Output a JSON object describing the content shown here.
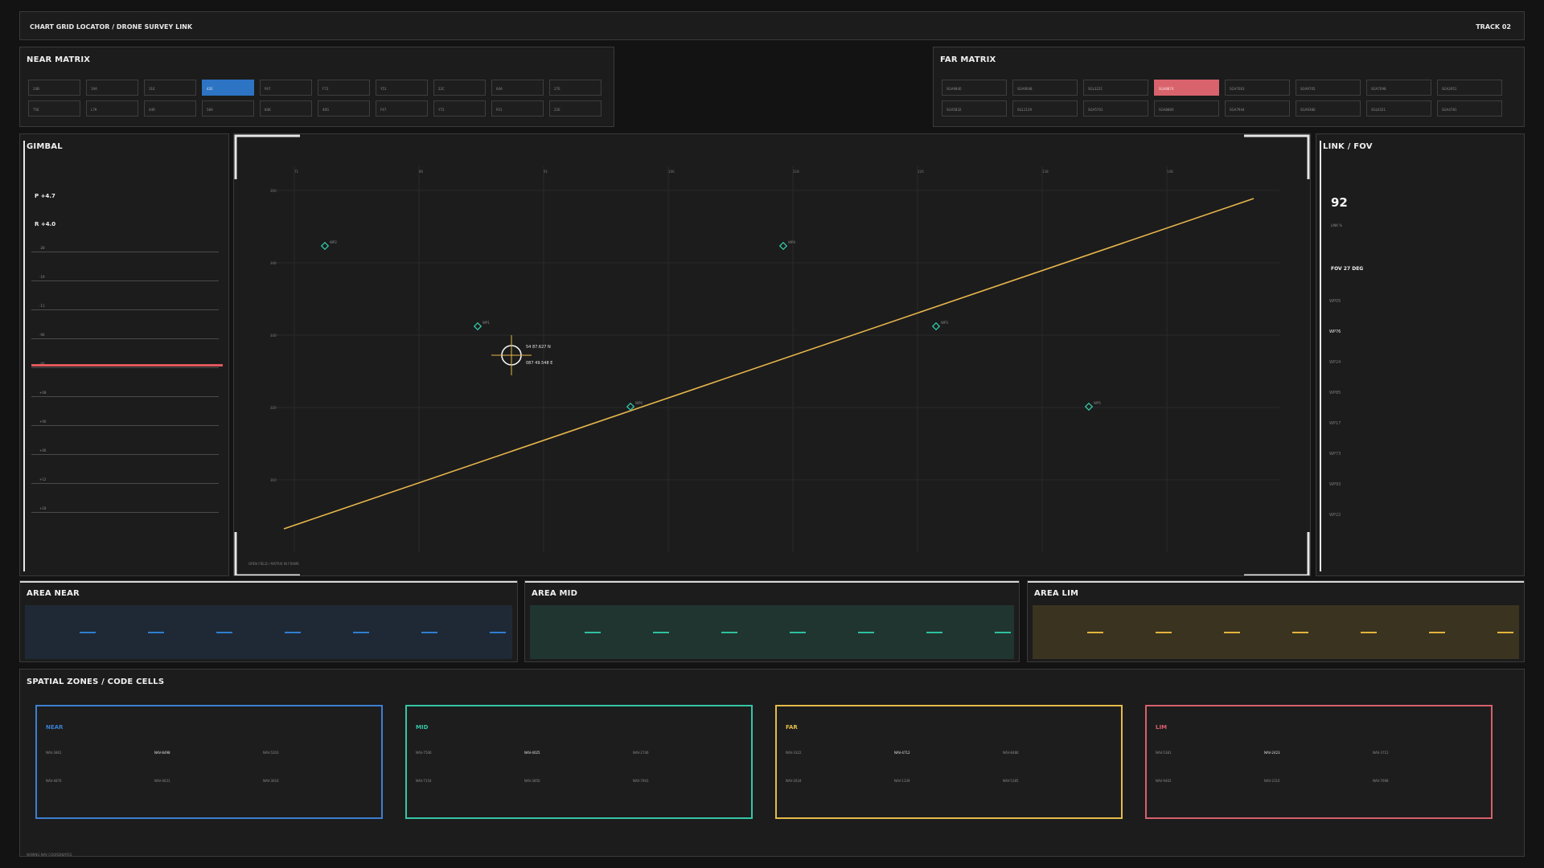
{
  "header": {
    "title": "CHART GRID LOCATOR  /  DRONE SURVEY LINK",
    "track": "TRACK 02"
  },
  "near_matrix": {
    "title": "NEAR MATRIX",
    "active_index": 3,
    "cells": [
      "24B",
      "19A",
      "31E",
      "42E",
      "P47",
      "F72",
      "Y51",
      "22C",
      "64A",
      "27E",
      "75E",
      "L79",
      "44R",
      "58A",
      "84K",
      "40G",
      "F47",
      "Y72",
      "P31",
      "22E"
    ]
  },
  "far_matrix": {
    "title": "FAR MATRIX",
    "active_index": 3,
    "cells": [
      "SGA9840",
      "SGA9048",
      "SGL3221",
      "SGA8874",
      "SGA7063",
      "SGA9705",
      "SGA7098",
      "SGA2951",
      "SGA5832",
      "SGL1129",
      "SGA5701",
      "SGA8860",
      "SGA7944",
      "SGA9380",
      "SGL0321",
      "SGA4781"
    ]
  },
  "gimbal": {
    "title": "GIMBAL",
    "pitch": "P +4.7",
    "roll": "R +4.0",
    "ticks": [
      "-28",
      "-19",
      "-11",
      "-06",
      "-04",
      "+08",
      "+06",
      "+06",
      "+12",
      "+18"
    ]
  },
  "plot": {
    "x_labels": [
      "71",
      "86",
      "91",
      "106",
      "118",
      "126",
      "138",
      "148"
    ],
    "y_labels": [
      "350",
      "340",
      "330",
      "320",
      "310"
    ],
    "waypoints": [
      "WP2",
      "WP4",
      "WP1",
      "WP3",
      "WP6",
      "WP5",
      "WP7"
    ],
    "coord_lat": "54 87.627 N",
    "coord_lon": "087 49.548 E",
    "footer": "OPEN FIELD  /  MATRIX IN FRAME",
    "trend_color": "#e8b64c",
    "waypoint_color": "#33c9a7"
  },
  "link_fov": {
    "title": "LINK / FOV",
    "link_value": "92",
    "link_label": "LINK %",
    "fov": "FOV 27 DEG",
    "waypoints": [
      "WP05",
      "WP76",
      "WP24",
      "WP85",
      "WP17",
      "WP73",
      "WP93",
      "WP22"
    ],
    "active_waypoint": 1
  },
  "areas": [
    {
      "title": "AREA NEAR",
      "color": "#2f7dd0",
      "bg": "#1f2935"
    },
    {
      "title": "AREA MID",
      "color": "#2fc1a0",
      "bg": "#213530"
    },
    {
      "title": "AREA LIM",
      "color": "#e3b43c",
      "bg": "#3a3320"
    }
  ],
  "zones": {
    "title": "SPATIAL ZONES  /  CODE CELLS",
    "footer": "NAMING NAV COORDINATES",
    "items": [
      {
        "name": "NEAR",
        "color": "#3c7fd1",
        "highlight": 1,
        "codes": [
          "NAV-3861",
          "NAV-8498",
          "NAV-5203",
          "NAV-4876",
          "NAV-4631",
          "NAV-3616"
        ]
      },
      {
        "name": "MID",
        "color": "#35c6a6",
        "highlight": 1,
        "codes": [
          "NAV-7506",
          "NAV-4025",
          "NAV-2746",
          "NAV-7154",
          "NAV-3850",
          "NAV-7941"
        ]
      },
      {
        "name": "FAR",
        "color": "#e5bc49",
        "highlight": 1,
        "codes": [
          "NAV-3322",
          "NAV-4712",
          "NAV-8486",
          "NAV-2634",
          "NAV-1339",
          "NAV-5185"
        ]
      },
      {
        "name": "LIM",
        "color": "#d8606c",
        "highlight": 1,
        "codes": [
          "NAV-5381",
          "NAV-2423",
          "NAV-3712",
          "NAV-9402",
          "NAV-2316",
          "NAV-7698"
        ]
      }
    ]
  }
}
